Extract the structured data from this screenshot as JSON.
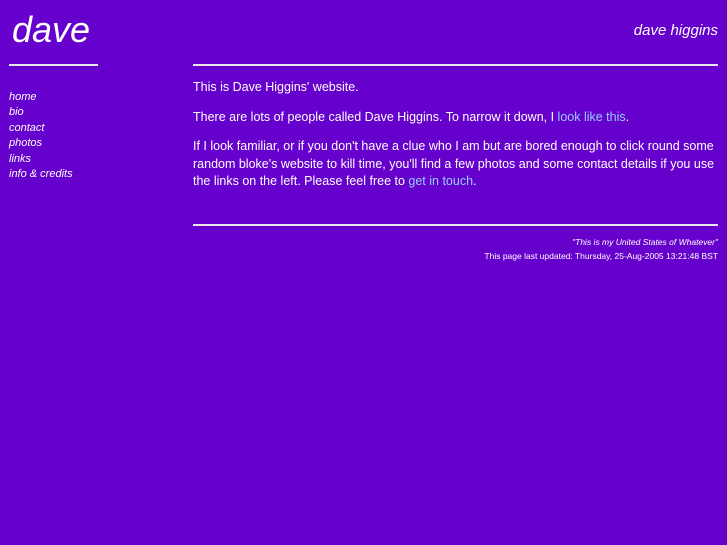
{
  "header": {
    "logo": "dave",
    "site_name": "dave higgins"
  },
  "nav": {
    "items": [
      {
        "label": "home"
      },
      {
        "label": "bio"
      },
      {
        "label": "contact"
      },
      {
        "label": "photos"
      },
      {
        "label": "links"
      },
      {
        "label": "info & credits"
      }
    ]
  },
  "content": {
    "p1": "This is Dave Higgins' website.",
    "p2_text": "There are lots of people called Dave Higgins. To narrow it down, I ",
    "p2_link": "look like this",
    "p2_end": ".",
    "p3_text": "If I look familiar, or if you don't have a clue who I am but are bored enough to click round some random bloke's website to kill time, you'll find a few photos and some contact details if you use the links on the left. Please feel free to ",
    "p3_link": "get in touch",
    "p3_end": "."
  },
  "footer": {
    "quote": "\"This is my United States of Whatever\"",
    "updated": "This page last updated: Thursday, 25-Aug-2005 13:21:48 BST"
  },
  "colors": {
    "background": "#6600cc",
    "text": "#ffffff",
    "link": "#99ccff",
    "rule": "#e8e8e8"
  }
}
